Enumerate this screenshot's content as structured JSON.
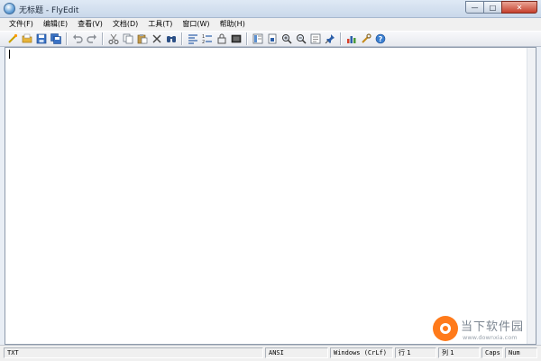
{
  "window": {
    "title": "无标题 - FlyEdit",
    "minimize_glyph": "—",
    "maximize_glyph": "□",
    "close_glyph": "✕"
  },
  "menu": {
    "items": [
      "文件(F)",
      "编辑(E)",
      "查看(V)",
      "文档(D)",
      "工具(T)",
      "窗口(W)",
      "帮助(H)"
    ]
  },
  "toolbar": {
    "buttons": [
      "new-file",
      "open-folder",
      "save",
      "save-all",
      "undo",
      "redo",
      "cut",
      "copy",
      "paste",
      "delete",
      "find",
      "align-left",
      "numbered-list",
      "lock",
      "fullscreen",
      "layout",
      "export",
      "zoom-in",
      "zoom-out",
      "page-view",
      "pin",
      "chart",
      "tools",
      "help"
    ]
  },
  "status": {
    "format": "TXT",
    "encoding": "ANSI",
    "line_ending": "Windows (CrLf)",
    "line": "行 1",
    "column": "列 1",
    "caps": "Caps",
    "num": "Num"
  },
  "watermark": {
    "text": "当下软件园",
    "url": "www.downxia.com"
  },
  "colors": {
    "accent": "#2f6fb0",
    "close_button": "#c5402d",
    "watermark_logo": "#ff7a1a"
  }
}
